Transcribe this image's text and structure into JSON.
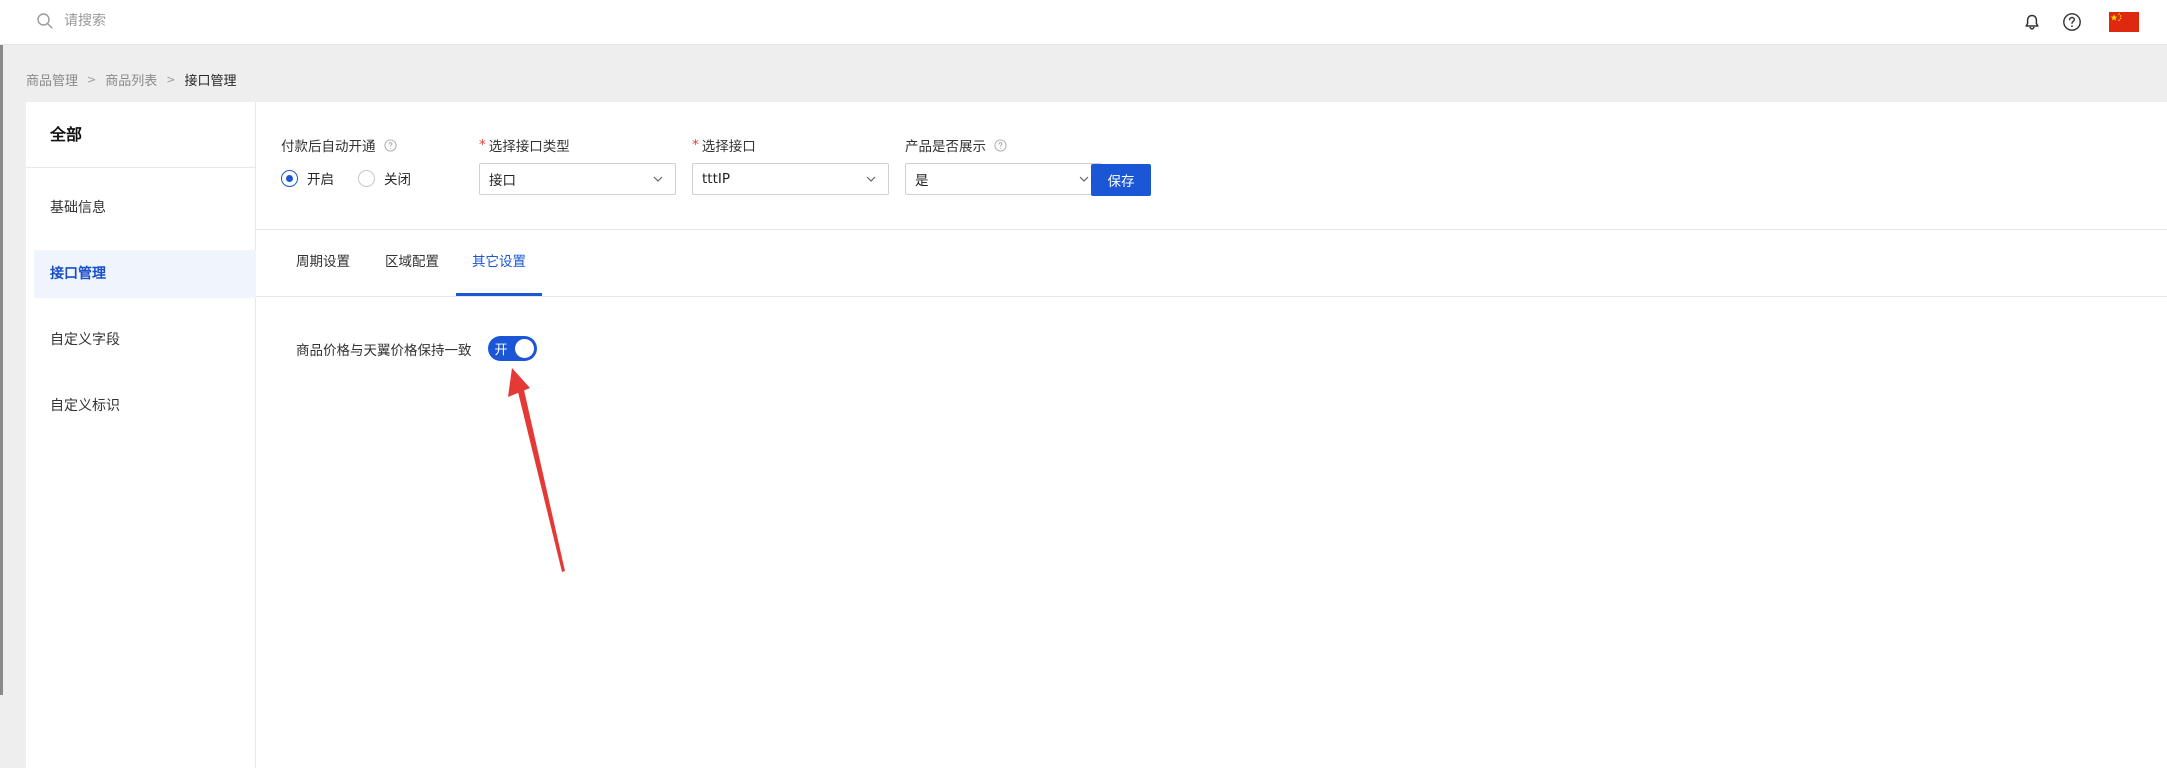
{
  "search": {
    "placeholder": "请搜索"
  },
  "topbar": {
    "icons": [
      "bell-icon",
      "help-icon",
      "china-flag"
    ]
  },
  "breadcrumb": [
    "商品管理",
    "商品列表",
    "接口管理"
  ],
  "sidebar": {
    "title": "全部",
    "items": [
      {
        "label": "基础信息",
        "active": false
      },
      {
        "label": "接口管理",
        "active": true
      },
      {
        "label": "自定义字段",
        "active": false
      },
      {
        "label": "自定义标识",
        "active": false
      }
    ]
  },
  "form": {
    "auto_open": {
      "label": "付款后自动开通",
      "options": [
        "开启",
        "关闭"
      ],
      "selected": "开启"
    },
    "interface_type": {
      "label": "选择接口类型",
      "required": true,
      "value": "接口"
    },
    "interface": {
      "label": "选择接口",
      "required": true,
      "value": "tttIP"
    },
    "display": {
      "label": "产品是否展示",
      "value": "是"
    },
    "save_label": "保存"
  },
  "tabs": [
    {
      "label": "周期设置",
      "active": false
    },
    {
      "label": "区域配置",
      "active": false
    },
    {
      "label": "其它设置",
      "active": true
    }
  ],
  "settings": {
    "price_sync": {
      "label": "商品价格与天翼价格保持一致",
      "switch_text": "开",
      "enabled": true
    }
  },
  "colors": {
    "primary": "#1a56d6",
    "annotation_arrow": "#e53935"
  }
}
